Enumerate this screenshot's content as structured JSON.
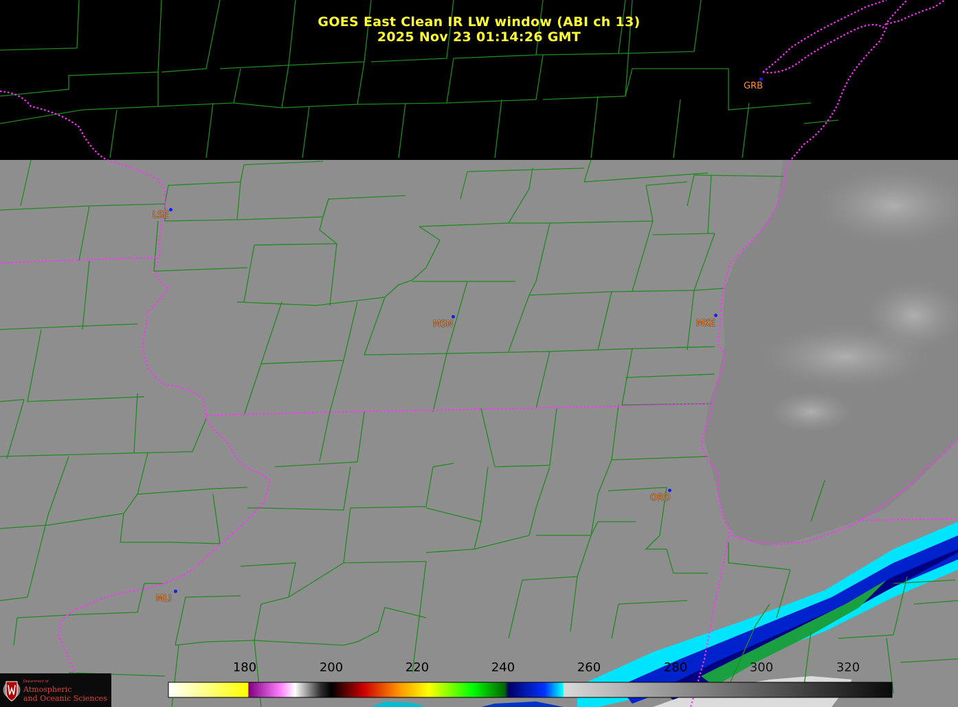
{
  "title": {
    "line1": "GOES East Clean IR LW window (ABI ch 13)",
    "line2": "2025 Nov 23  01:14:26 GMT"
  },
  "stations": [
    {
      "id": "GRB"
    },
    {
      "id": "LSE"
    },
    {
      "id": "MSN"
    },
    {
      "id": "MKE"
    },
    {
      "id": "ORD"
    },
    {
      "id": "MLI"
    }
  ],
  "colorbar": {
    "ticks": [
      "180",
      "200",
      "220",
      "240",
      "260",
      "280",
      "300",
      "320"
    ]
  },
  "logo": {
    "dept": "Department of",
    "line1": "Atmospheric",
    "line2": "and Oceanic Sciences"
  },
  "colors": {
    "title": "#ffff33",
    "station_label": "#ff8c33",
    "station_dot": "#1a1aff",
    "county_lines": "#1f8a1f",
    "state_lines": "#ff33ff",
    "land_gray": "#8e8e8e",
    "lake_gray": "#878787",
    "no_data": "#000000"
  }
}
